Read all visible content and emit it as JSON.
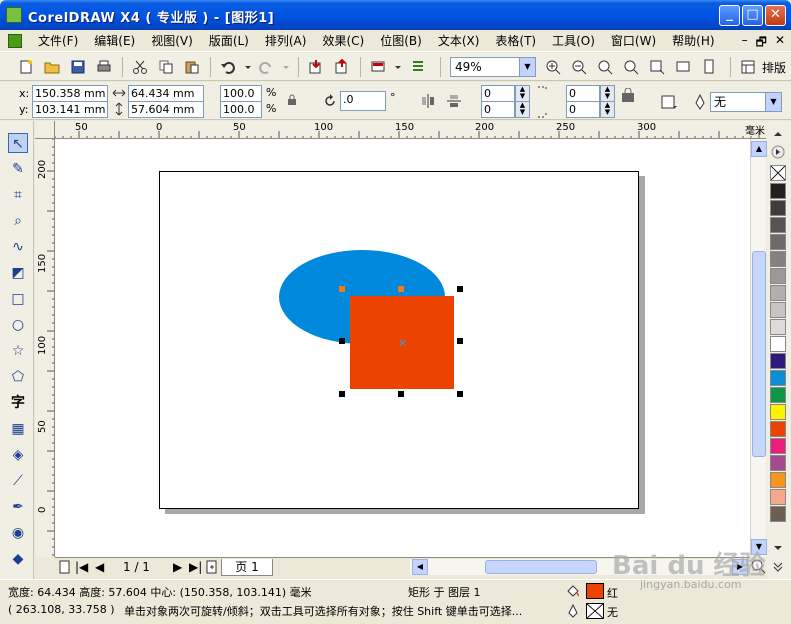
{
  "window": {
    "title": "CorelDRAW X4 ( 专业版 ) - [图形1]",
    "minimize": "_",
    "maximize": "□",
    "close": "✕"
  },
  "menu": {
    "items": [
      "文件(F)",
      "编辑(E)",
      "视图(V)",
      "版面(L)",
      "排列(A)",
      "效果(C)",
      "位图(B)",
      "文本(X)",
      "表格(T)",
      "工具(O)",
      "窗口(W)",
      "帮助(H)"
    ],
    "doc_controls": [
      "–",
      "🗗",
      "✕"
    ]
  },
  "standard_toolbar": {
    "zoom_value": "49%",
    "layout_label": "排版"
  },
  "property_bar": {
    "x_label": "x:",
    "y_label": "y:",
    "x_value": "150.358 mm",
    "y_value": "103.141 mm",
    "width_value": "64.434 mm",
    "height_value": "57.604 mm",
    "scale_x": "100.0",
    "scale_y": "100.0",
    "percent": "%",
    "rotation": ".0",
    "degree": "°",
    "corner_values": [
      "0",
      "0",
      "0",
      "0"
    ],
    "outline_width": "无"
  },
  "rulers": {
    "unit": "毫米",
    "h_labels": [
      "50",
      "0",
      "50",
      "100",
      "150",
      "200",
      "250",
      "300"
    ],
    "v_labels": [
      "200",
      "150",
      "100",
      "50",
      "0"
    ]
  },
  "page_nav": {
    "page_count": "1 / 1",
    "page_tab": "页 1"
  },
  "status": {
    "line1": "宽度: 64.434  高度: 57.604  中心: (150.358, 103.141)  毫米",
    "object_info": "矩形 于 图层 1",
    "line2": "( 263.108, 33.758 )",
    "hint": "单击对象两次可旋转/倾斜；双击工具可选择所有对象；按住 Shift 键单击可选择...",
    "fill_name": "红",
    "outline_name": "无"
  },
  "colors": {
    "ellipse": "#0089dc",
    "rectangle": "#ed4300",
    "palette": [
      "#231f20",
      "#3d3b3c",
      "#555354",
      "#6c6a6b",
      "#838182",
      "#9a9899",
      "#b0aeaf",
      "#c6c4c5",
      "#dcdadb",
      "#ffffff",
      "#2e1a7a",
      "#0a8ed8",
      "#0f9548",
      "#fff200",
      "#ed4300",
      "#ed1e79",
      "#a44a8e",
      "#f7941d",
      "#f7a88c",
      "#6d5e52"
    ]
  },
  "watermark": {
    "brand": "Bai du 经验",
    "url": "jingyan.baidu.com"
  }
}
